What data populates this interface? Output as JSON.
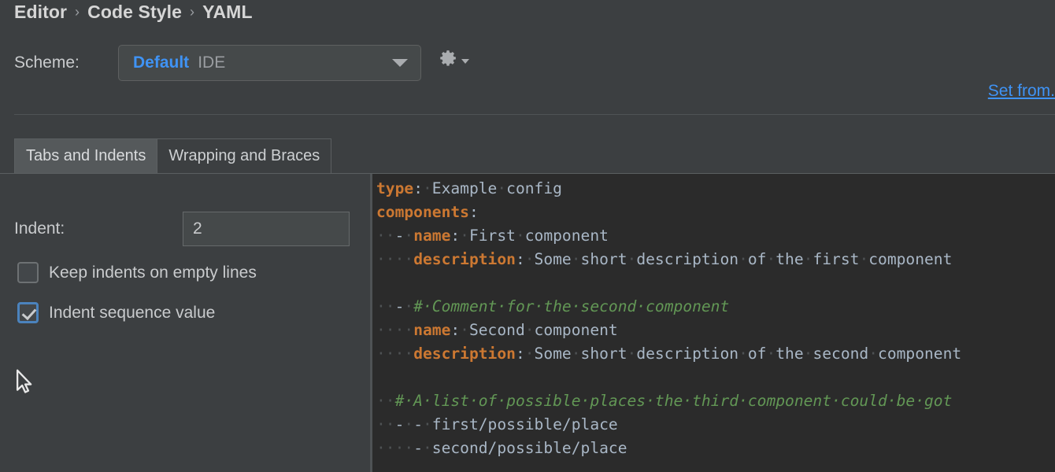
{
  "breadcrumb": {
    "items": [
      "Editor",
      "Code Style",
      "YAML"
    ],
    "separator": "›"
  },
  "scheme": {
    "label": "Scheme:",
    "value": "Default",
    "scope": "IDE",
    "gear_icon": "gear-icon",
    "set_from_link": "Set from."
  },
  "tabs": [
    {
      "label": "Tabs and Indents",
      "selected": true
    },
    {
      "label": "Wrapping and Braces",
      "selected": false
    }
  ],
  "settings": {
    "indent": {
      "label": "Indent:",
      "value": "2",
      "placeholder": ""
    },
    "checkboxes": [
      {
        "label": "Keep indents on empty lines",
        "checked": false
      },
      {
        "label": "Indent sequence value",
        "checked": true
      }
    ]
  },
  "editor": {
    "colors": {
      "background": "#2b2b2b",
      "key": "#cc7832",
      "value": "#a9b7c6",
      "comment": "#629755",
      "indent_highlight": "#164b16",
      "whitespace_dot": "#4e5254"
    },
    "lines": [
      {
        "indent_blocks": [],
        "tokens": [
          {
            "t": "type",
            "c": "k"
          },
          {
            "t": ":",
            "c": "p"
          },
          {
            "t": "·",
            "c": "d"
          },
          {
            "t": "Example",
            "c": "v"
          },
          {
            "t": "·",
            "c": "d"
          },
          {
            "t": "config",
            "c": "v"
          }
        ]
      },
      {
        "indent_blocks": [],
        "tokens": [
          {
            "t": "components",
            "c": "k"
          },
          {
            "t": ":",
            "c": "p"
          }
        ]
      },
      {
        "indent_blocks": [
          {
            "start": 0,
            "len": 2
          }
        ],
        "tokens": [
          {
            "t": "··",
            "c": "d"
          },
          {
            "t": "-",
            "c": "dash"
          },
          {
            "t": "·",
            "c": "d"
          },
          {
            "t": "name",
            "c": "k"
          },
          {
            "t": ":",
            "c": "p"
          },
          {
            "t": "·",
            "c": "d"
          },
          {
            "t": "First",
            "c": "v"
          },
          {
            "t": "·",
            "c": "d"
          },
          {
            "t": "component",
            "c": "v"
          }
        ]
      },
      {
        "indent_blocks": [
          {
            "start": 2,
            "len": 2
          }
        ],
        "tokens": [
          {
            "t": "····",
            "c": "d"
          },
          {
            "t": "description",
            "c": "k"
          },
          {
            "t": ":",
            "c": "p"
          },
          {
            "t": "·",
            "c": "d"
          },
          {
            "t": "Some",
            "c": "v"
          },
          {
            "t": "·",
            "c": "d"
          },
          {
            "t": "short",
            "c": "v"
          },
          {
            "t": "·",
            "c": "d"
          },
          {
            "t": "description",
            "c": "v"
          },
          {
            "t": "·",
            "c": "d"
          },
          {
            "t": "of",
            "c": "v"
          },
          {
            "t": "·",
            "c": "d"
          },
          {
            "t": "the",
            "c": "v"
          },
          {
            "t": "·",
            "c": "d"
          },
          {
            "t": "first",
            "c": "v"
          },
          {
            "t": "·",
            "c": "d"
          },
          {
            "t": "component",
            "c": "v"
          }
        ]
      },
      {
        "indent_blocks": [],
        "tokens": []
      },
      {
        "indent_blocks": [
          {
            "start": 0,
            "len": 2
          }
        ],
        "tokens": [
          {
            "t": "··",
            "c": "d"
          },
          {
            "t": "-",
            "c": "dash"
          },
          {
            "t": "·",
            "c": "d"
          },
          {
            "t": "#·Comment·for·the·second·component",
            "c": "c"
          }
        ]
      },
      {
        "indent_blocks": [
          {
            "start": 2,
            "len": 2
          }
        ],
        "tokens": [
          {
            "t": "····",
            "c": "d"
          },
          {
            "t": "name",
            "c": "k"
          },
          {
            "t": ":",
            "c": "p"
          },
          {
            "t": "·",
            "c": "d"
          },
          {
            "t": "Second",
            "c": "v"
          },
          {
            "t": "·",
            "c": "d"
          },
          {
            "t": "component",
            "c": "v"
          }
        ]
      },
      {
        "indent_blocks": [
          {
            "start": 2,
            "len": 2
          }
        ],
        "tokens": [
          {
            "t": "····",
            "c": "d"
          },
          {
            "t": "description",
            "c": "k"
          },
          {
            "t": ":",
            "c": "p"
          },
          {
            "t": "·",
            "c": "d"
          },
          {
            "t": "Some",
            "c": "v"
          },
          {
            "t": "·",
            "c": "d"
          },
          {
            "t": "short",
            "c": "v"
          },
          {
            "t": "·",
            "c": "d"
          },
          {
            "t": "description",
            "c": "v"
          },
          {
            "t": "·",
            "c": "d"
          },
          {
            "t": "of",
            "c": "v"
          },
          {
            "t": "·",
            "c": "d"
          },
          {
            "t": "the",
            "c": "v"
          },
          {
            "t": "·",
            "c": "d"
          },
          {
            "t": "second",
            "c": "v"
          },
          {
            "t": "·",
            "c": "d"
          },
          {
            "t": "component",
            "c": "v"
          }
        ]
      },
      {
        "indent_blocks": [],
        "tokens": []
      },
      {
        "indent_blocks": [],
        "tokens": [
          {
            "t": "··",
            "c": "d"
          },
          {
            "t": "#·A·list·of·possible·places·the·third·component·could·be·got",
            "c": "c"
          }
        ]
      },
      {
        "indent_blocks": [
          {
            "start": 0,
            "len": 2
          }
        ],
        "tokens": [
          {
            "t": "··",
            "c": "d"
          },
          {
            "t": "-",
            "c": "dash"
          },
          {
            "t": "·",
            "c": "d"
          },
          {
            "t": "-",
            "c": "dash"
          },
          {
            "t": "·",
            "c": "d"
          },
          {
            "t": "first/possible/place",
            "c": "v"
          }
        ]
      },
      {
        "indent_blocks": [
          {
            "start": 2,
            "len": 2
          }
        ],
        "tokens": [
          {
            "t": "····",
            "c": "d"
          },
          {
            "t": "-",
            "c": "dash"
          },
          {
            "t": "·",
            "c": "d"
          },
          {
            "t": "second/possible/place",
            "c": "v"
          }
        ]
      }
    ]
  }
}
